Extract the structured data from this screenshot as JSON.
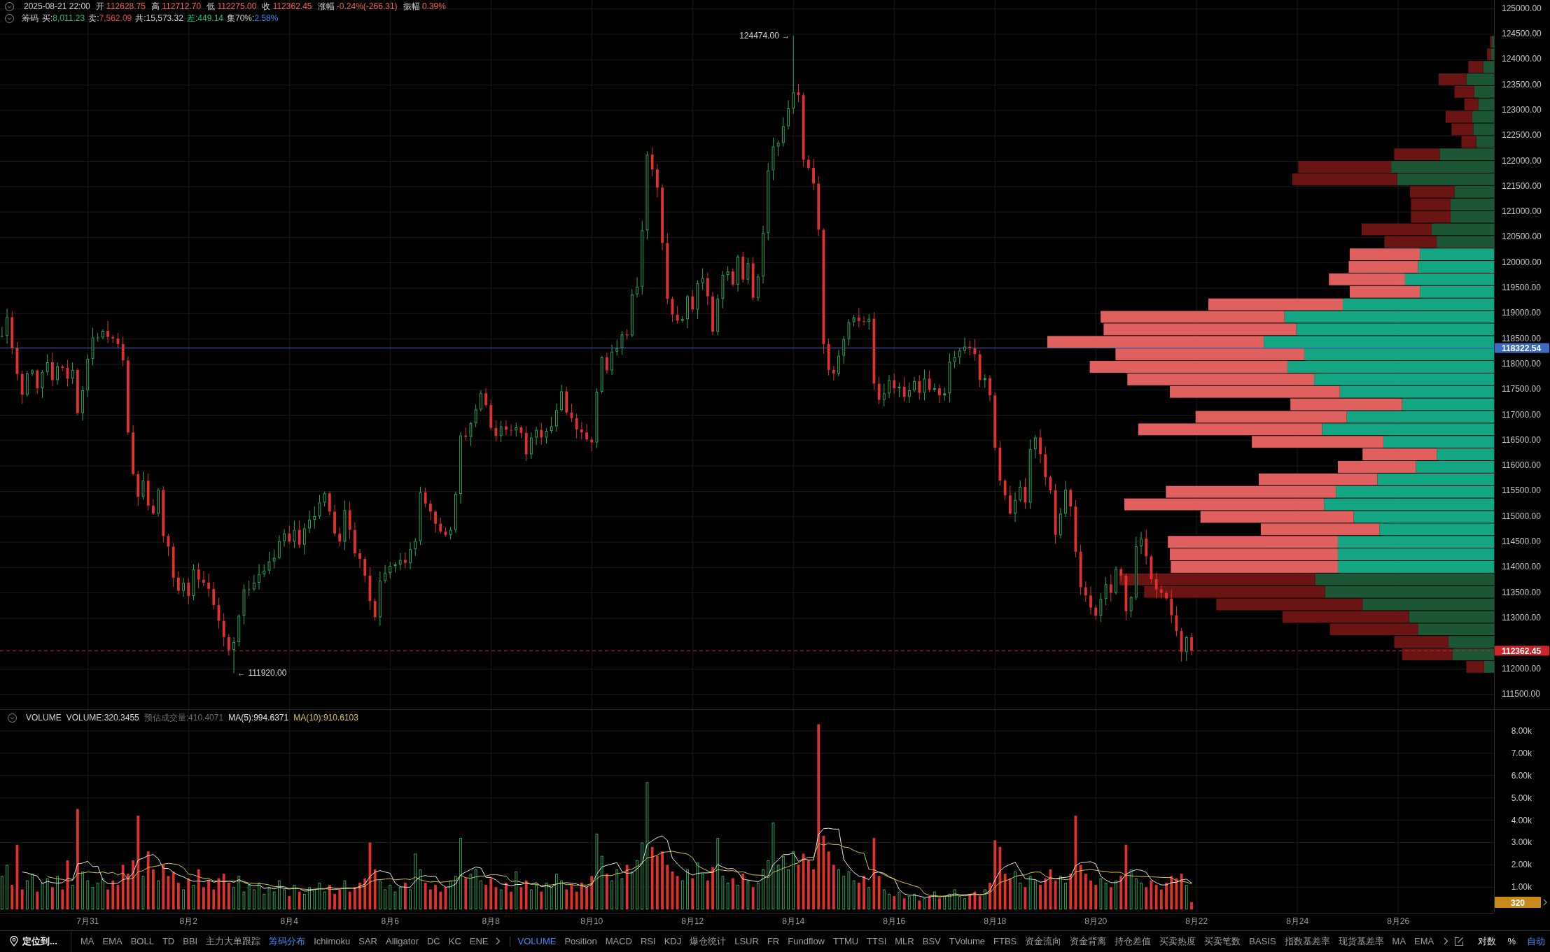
{
  "ohlc_legend": {
    "time": "2025-08-21 22:00",
    "fields": [
      {
        "label": "开",
        "value": "112628.75"
      },
      {
        "label": "高",
        "value": "112712.70"
      },
      {
        "label": "低",
        "value": "112275.00"
      },
      {
        "label": "收",
        "value": "112362.45"
      },
      {
        "label": "涨幅",
        "value": "-0.24%(-266.31)"
      },
      {
        "label": "振幅",
        "value": "0.39%"
      }
    ]
  },
  "chip_legend": {
    "title": "筹码",
    "items": [
      {
        "kind": "buy",
        "label": "买:",
        "value": "8,011.23"
      },
      {
        "kind": "sell",
        "label": "卖:",
        "value": "7,562.09"
      },
      {
        "kind": "total",
        "label": "共:",
        "value": "15,573.32"
      },
      {
        "kind": "diff",
        "label": "差:",
        "value": "449.14"
      },
      {
        "kind": "concentration",
        "label": "集70%:",
        "value": "2.58%"
      }
    ]
  },
  "price_chart": {
    "high_label": "124474.00 →",
    "low_label": "← 111920.00",
    "axis_labels": [
      "125000.00",
      "124500.00",
      "124000.00",
      "123500.00",
      "123000.00",
      "122500.00",
      "122000.00",
      "121500.00",
      "121000.00",
      "120500.00",
      "120000.00",
      "119500.00",
      "119000.00",
      "118500.00",
      "118000.00",
      "117500.00",
      "117000.00",
      "116500.00",
      "116000.00",
      "115500.00",
      "115000.00",
      "114500.00",
      "114000.00",
      "113500.00",
      "113000.00",
      "112000.00",
      "111500.00"
    ],
    "price_tags": [
      {
        "label": "118322.54",
        "color": "#3a6cc0"
      },
      {
        "label": "112362.45",
        "color": "#d3242a"
      }
    ]
  },
  "volume_pane": {
    "legend": {
      "items": [
        {
          "kind": "title",
          "text": "VOLUME"
        },
        {
          "kind": "value",
          "text": "VOLUME:320.3455"
        },
        {
          "kind": "estimate",
          "text": "预估成交量:410.4071"
        },
        {
          "kind": "ma",
          "text": "MA(5):994.6371",
          "color": "#e6e6e6"
        },
        {
          "kind": "ma",
          "text": "MA(10):910.6103",
          "color": "#d6c443"
        }
      ]
    },
    "axis_labels": [
      "8.00k",
      "7.00k",
      "6.00k",
      "5.00k",
      "4.00k",
      "3.00k",
      "2.00k",
      "1.00k"
    ],
    "value_tag": "320"
  },
  "date_labels": [
    "7月31",
    "8月2",
    "8月4",
    "8月6",
    "8月8",
    "8月10",
    "8月12",
    "8月14",
    "8月16",
    "8月18",
    "8月20",
    "8月22",
    "8月24",
    "8月26"
  ],
  "toolbar": {
    "locate_button": "定位到...",
    "main_indicators": [
      {
        "label": "MA",
        "selected": false
      },
      {
        "label": "EMA",
        "selected": false
      },
      {
        "label": "BOLL",
        "selected": false
      },
      {
        "label": "TD",
        "selected": false
      },
      {
        "label": "BBI",
        "selected": false
      },
      {
        "label": "主力大单跟踪",
        "selected": false
      },
      {
        "label": "筹码分布",
        "selected": true
      },
      {
        "label": "Ichimoku",
        "selected": false
      },
      {
        "label": "SAR",
        "selected": false
      },
      {
        "label": "Alligator",
        "selected": false
      },
      {
        "label": "DC",
        "selected": false
      },
      {
        "label": "KC",
        "selected": false
      },
      {
        "label": "ENE",
        "selected": false
      }
    ],
    "sub_indicators": [
      {
        "label": "VOLUME",
        "selected": true
      },
      {
        "label": "Position",
        "selected": false
      },
      {
        "label": "MACD",
        "selected": false
      },
      {
        "label": "RSI",
        "selected": false
      },
      {
        "label": "KDJ",
        "selected": false
      },
      {
        "label": "爆仓统计",
        "selected": false
      },
      {
        "label": "LSUR",
        "selected": false
      },
      {
        "label": "FR",
        "selected": false
      },
      {
        "label": "Fundflow",
        "selected": false
      },
      {
        "label": "TTMU",
        "selected": false
      },
      {
        "label": "TTSI",
        "selected": false
      },
      {
        "label": "MLR",
        "selected": false
      },
      {
        "label": "BSV",
        "selected": false
      },
      {
        "label": "TVolume",
        "selected": false
      },
      {
        "label": "FTBS",
        "selected": false
      },
      {
        "label": "资金流向",
        "selected": false
      },
      {
        "label": "资金背离",
        "selected": false
      },
      {
        "label": "持仓差值",
        "selected": false
      },
      {
        "label": "买卖热度",
        "selected": false
      },
      {
        "label": "买卖笔数",
        "selected": false
      },
      {
        "label": "BASIS",
        "selected": false
      },
      {
        "label": "指数基差率",
        "selected": false
      },
      {
        "label": "现货基差率",
        "selected": false
      },
      {
        "label": "MA",
        "selected": false
      },
      {
        "label": "EMA",
        "selected": false
      }
    ],
    "scale_options": [
      {
        "label": "对数",
        "selected": false
      },
      {
        "label": "%",
        "selected": false
      },
      {
        "label": "自动",
        "selected": true
      }
    ]
  }
}
